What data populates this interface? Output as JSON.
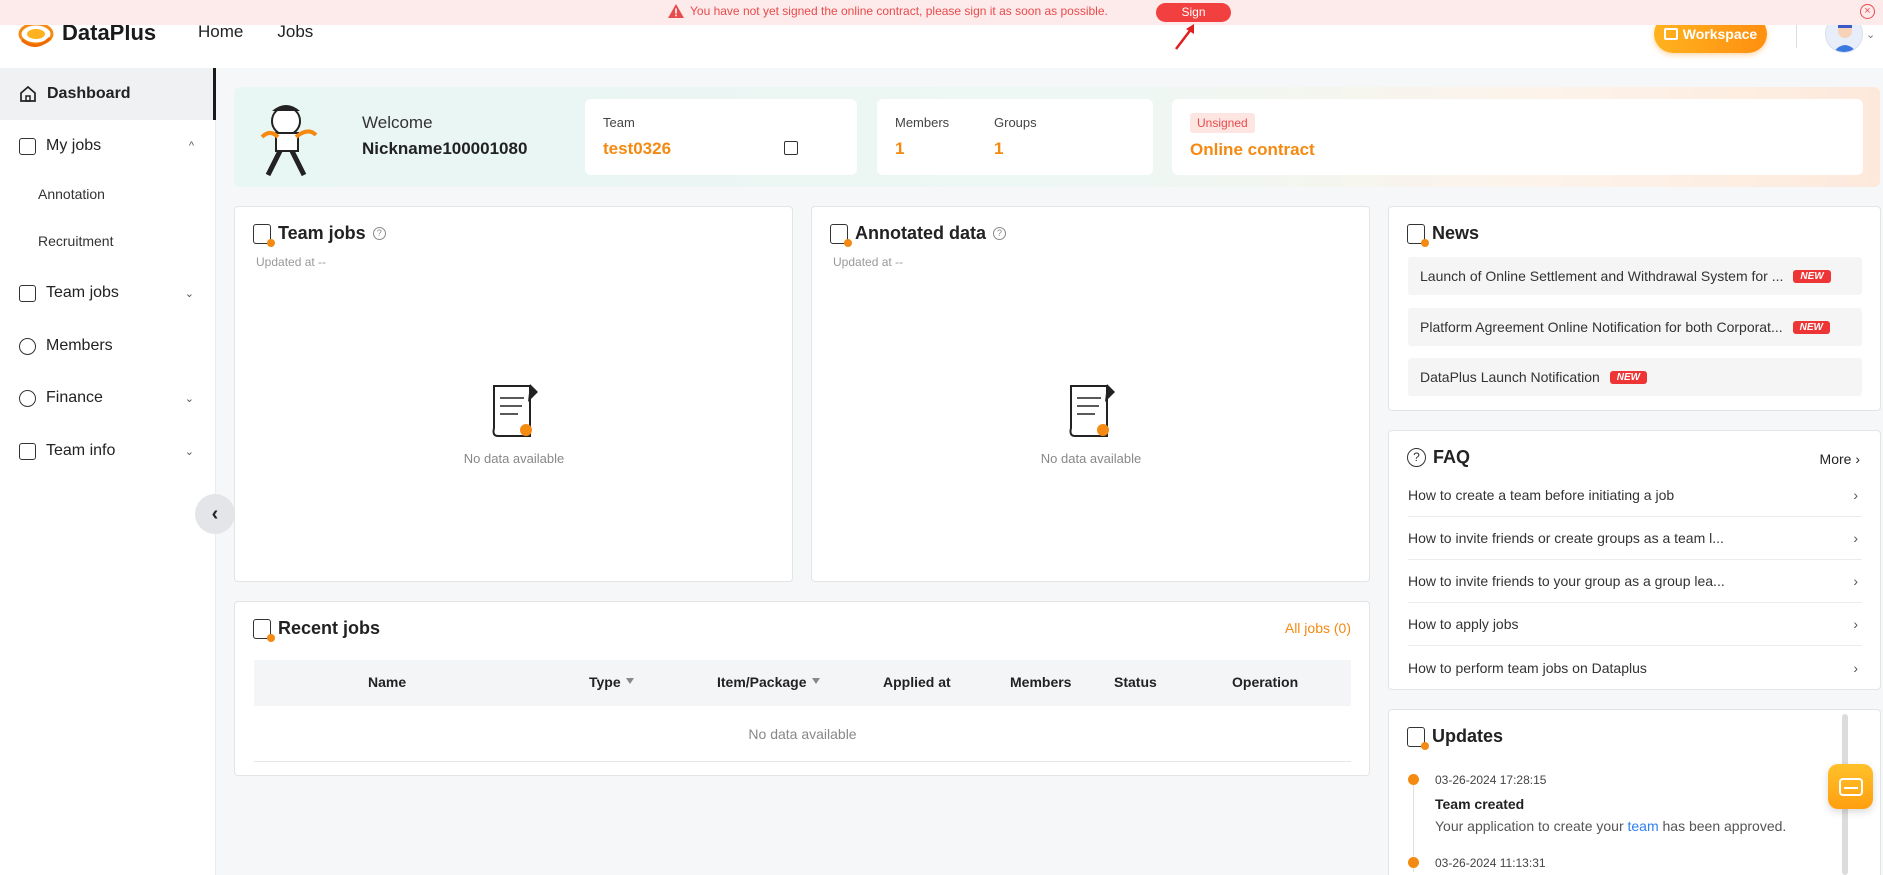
{
  "banner": {
    "message": "You have not yet signed the online contract, please sign it as soon as possible.",
    "sign_label": "Sign",
    "close_glyph": "×",
    "warning_icon": "warning-triangle-icon"
  },
  "header": {
    "logo_text": "DataPlus",
    "nav": [
      "Home",
      "Jobs"
    ],
    "workspace_label": "Workspace",
    "chevron": "⌄"
  },
  "sidebar": {
    "items": [
      {
        "label": "Dashboard",
        "icon": "home-icon"
      },
      {
        "label": "My jobs",
        "icon": "jobs-icon",
        "chevron": "^"
      },
      {
        "label": "Team jobs",
        "icon": "team-jobs-icon",
        "chevron": "⌄"
      },
      {
        "label": "Members",
        "icon": "members-icon"
      },
      {
        "label": "Finance",
        "icon": "finance-icon",
        "chevron": "⌄"
      },
      {
        "label": "Team info",
        "icon": "team-info-icon",
        "chevron": "⌄"
      }
    ],
    "sub_items": [
      "Annotation",
      "Recruitment"
    ],
    "collapse_glyph": "‹"
  },
  "welcome": {
    "label": "Welcome",
    "name": "Nickname100001080",
    "team_label": "Team",
    "team_value": "test0326",
    "members_label": "Members",
    "members_value": "1",
    "groups_label": "Groups",
    "groups_value": "1",
    "contract_badge": "Unsigned",
    "contract_label": "Online contract"
  },
  "team_jobs": {
    "title": "Team jobs",
    "help": "?",
    "updated": "Updated at --",
    "empty": "No data available"
  },
  "annotated": {
    "title": "Annotated data",
    "help": "?",
    "updated": "Updated at --",
    "empty": "No data available"
  },
  "news": {
    "title": "News",
    "badge": "NEW",
    "items": [
      "Launch of Online Settlement and Withdrawal System for ...",
      "Platform Agreement Online Notification for both Corporat...",
      "DataPlus Launch Notification"
    ]
  },
  "faq": {
    "title": "FAQ",
    "more": "More ›",
    "chevron": "›",
    "items": [
      "How to create a team before initiating a job",
      "How to invite friends or create groups as a team l...",
      "How to invite friends to your group as a group lea...",
      "How to apply jobs",
      "How to perform team jobs on Dataplus"
    ]
  },
  "recent_jobs": {
    "title": "Recent jobs",
    "all_jobs": "All jobs (0)",
    "columns": [
      "Name",
      "Type",
      "Item/Package",
      "Applied at",
      "Members",
      "Status",
      "Operation"
    ],
    "empty": "No data available"
  },
  "updates": {
    "title": "Updates",
    "entries": [
      {
        "time": "03-26-2024 17:28:15",
        "title": "Team created",
        "desc_before": "Your application to create your ",
        "link": "team",
        "desc_after": " has been approved."
      },
      {
        "time": "03-26-2024 11:13:31"
      }
    ]
  },
  "colors": {
    "accent": "#f48a12",
    "danger": "#e84b4b",
    "link": "#2f7ff0"
  }
}
